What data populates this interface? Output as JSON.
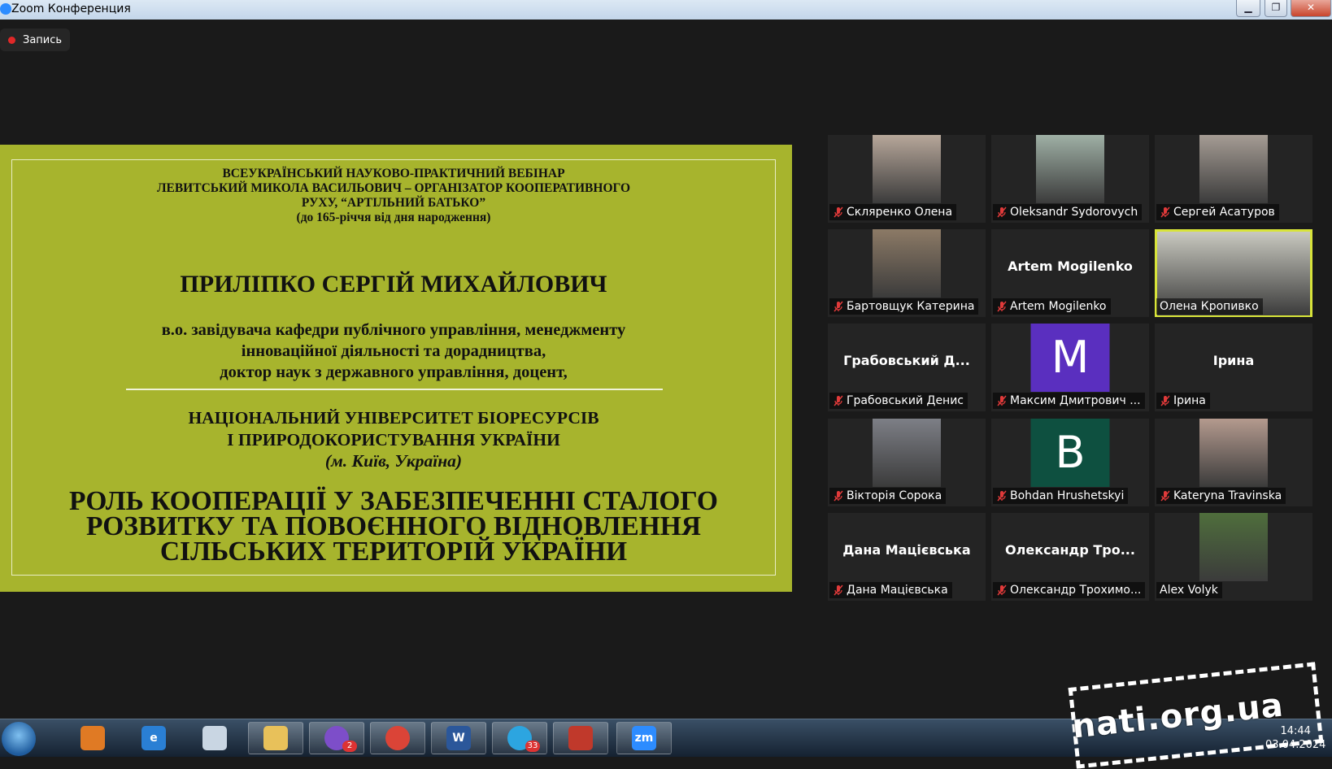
{
  "window": {
    "title": "Zoom Конференция"
  },
  "recording": {
    "label": "Запись"
  },
  "slide": {
    "header_lines": [
      "ВСЕУКРАЇНСЬКИЙ НАУКОВО-ПРАКТИЧНИЙ ВЕБІНАР",
      "ЛЕВИТСЬКИЙ МИКОЛА ВАСИЛЬОВИЧ – ОРГАНІЗАТОР КООПЕРАТИВНОГО",
      "РУХУ, “АРТІЛЬНИЙ БАТЬКО”",
      "(до 165-річчя від дня народження)"
    ],
    "speaker": "ПРИЛІПКО СЕРГІЙ МИХАЙЛОВИЧ",
    "position_lines": [
      "в.о. завідувача кафедри публічного управління, менеджменту",
      "інноваційної діяльності та дорадництва,",
      "доктор наук з державного управління, доцент,"
    ],
    "university_lines": [
      "НАЦІОНАЛЬНИЙ УНІВЕРСИТЕТ БІОРЕСУРСІВ",
      "І ПРИРОДОКОРИСТУВАННЯ УКРАЇНИ"
    ],
    "city": "(м. Київ, Україна)",
    "topic_lines": [
      "РОЛЬ КООПЕРАЦІЇ У ЗАБЕЗПЕЧЕННІ СТАЛОГО",
      "РОЗВИТКУ ТА ПОВОЄННОГО ВІДНОВЛЕННЯ",
      "СІЛЬСЬКИХ ТЕРИТОРІЙ УКРАЇНИ"
    ]
  },
  "participants": [
    {
      "name": "Скляренко Олена",
      "muted": true,
      "kind": "video",
      "color": "#b7a79a"
    },
    {
      "name": "Oleksandr Sydorovych",
      "muted": true,
      "kind": "video",
      "color": "#9fb0a5"
    },
    {
      "name": "Сергей Асатуров",
      "muted": true,
      "kind": "video",
      "color": "#a59c94"
    },
    {
      "name": "Бартовщук Катерина",
      "muted": true,
      "kind": "video",
      "color": "#8c7a66"
    },
    {
      "name": "Artem Mogilenko",
      "muted": true,
      "kind": "name",
      "display": "Artem Mogilenko"
    },
    {
      "name": "Олена Кропивко",
      "muted": false,
      "kind": "video",
      "color": "#c9c9c0",
      "active": true
    },
    {
      "name": "Грабовський Денис",
      "muted": true,
      "kind": "name",
      "display": "Грабовський  Д..."
    },
    {
      "name": "Максим Дмитрович ...",
      "muted": true,
      "kind": "letter",
      "letter": "M",
      "color": "#5a2fbf"
    },
    {
      "name": "Ірина",
      "muted": true,
      "kind": "name",
      "display": "Ірина"
    },
    {
      "name": "Вікторія Сорока",
      "muted": true,
      "kind": "video",
      "color": "#7d7f86"
    },
    {
      "name": "Bohdan Hrushetskyi",
      "muted": true,
      "kind": "letter",
      "letter": "B",
      "color": "#0e5040"
    },
    {
      "name": "Kateryna Travinska",
      "muted": true,
      "kind": "video",
      "color": "#b49a8e"
    },
    {
      "name": "Дана Мацієвська",
      "muted": true,
      "kind": "name",
      "display": "Дана Мацієвська"
    },
    {
      "name": "Олександр Трохимо...",
      "muted": true,
      "kind": "name",
      "display": "Олександр  Тро..."
    },
    {
      "name": "Alex Volyk",
      "muted": false,
      "kind": "video",
      "color": "#4f6e3c"
    }
  ],
  "taskbar": {
    "apps": [
      {
        "id": "media-player",
        "label": "",
        "color": "#e07a24"
      },
      {
        "id": "ie",
        "label": "e",
        "color": "#2a7fd4"
      },
      {
        "id": "calculator",
        "label": "",
        "color": "#c9d6e3"
      },
      {
        "id": "explorer",
        "label": "",
        "color": "#e8c15a"
      },
      {
        "id": "viber",
        "label": "",
        "color": "#7d4ec9",
        "badge": "2"
      },
      {
        "id": "chrome",
        "label": "",
        "color": "#db4437"
      },
      {
        "id": "word",
        "label": "W",
        "color": "#2b579a"
      },
      {
        "id": "telegram",
        "label": "",
        "color": "#2ca5e0",
        "badge": "33"
      },
      {
        "id": "floppy",
        "label": "",
        "color": "#c0392b"
      },
      {
        "id": "zoom",
        "label": "zm",
        "color": "#2d8cff"
      }
    ],
    "clock": {
      "time": "14:44",
      "date": "03.04.2024"
    }
  },
  "watermark": "nati.org.ua"
}
